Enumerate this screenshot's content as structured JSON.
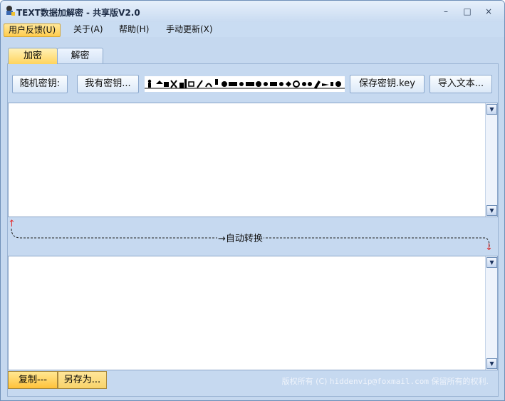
{
  "window": {
    "title": "TEXT数据加解密 - 共享版V2.0"
  },
  "title_buttons": {
    "minimize": "–",
    "maximize": "□",
    "close": "×"
  },
  "menu": [
    {
      "label": "用户反馈(U)"
    },
    {
      "label": "关于(A)"
    },
    {
      "label": "帮助(H)"
    },
    {
      "label": "手动更新(X)"
    }
  ],
  "tabs": [
    {
      "label": "加密"
    },
    {
      "label": "解密"
    }
  ],
  "toolbar": {
    "random_key": "随机密钥:",
    "have_key": "我有密钥...",
    "save_key": "保存密钥.key",
    "import_text": "导入文本..."
  },
  "convert": {
    "label": "→自动转换",
    "arrow_up": "↑",
    "arrow_down": "↓"
  },
  "footer": {
    "copy": "复制---",
    "save_as": "另存为...",
    "copyright_prefix": "版权所有 (C) ",
    "email": "hiddenvip@foxmail.com",
    "copyright_suffix": " 保留所有的权利."
  }
}
